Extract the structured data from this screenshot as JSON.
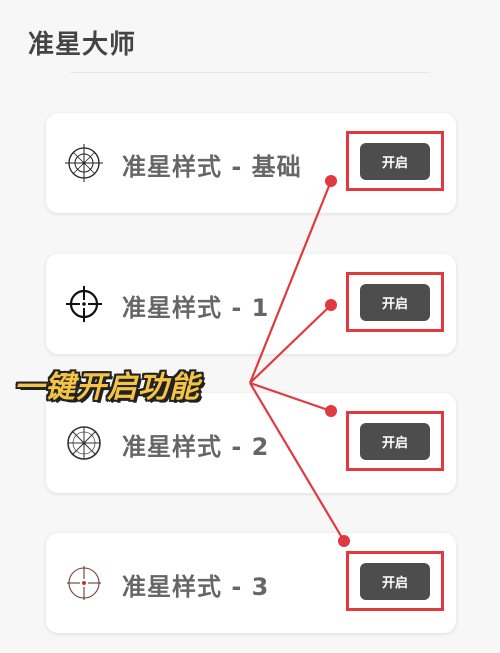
{
  "page": {
    "title": "准星大师"
  },
  "crosshairs": [
    {
      "label": "准星样式 - 基础",
      "icon": "crosshair-basic-icon",
      "button": "开启"
    },
    {
      "label": "准星样式 - 1",
      "icon": "crosshair-style-1-icon",
      "button": "开启"
    },
    {
      "label": "准星样式 - 2",
      "icon": "crosshair-style-2-icon",
      "button": "开启"
    },
    {
      "label": "准星样式 - 3",
      "icon": "crosshair-style-3-icon",
      "button": "开启"
    }
  ],
  "annotation": {
    "callout": "一键开启功能",
    "color": "#e0393f",
    "text_color": "#f6c445"
  }
}
